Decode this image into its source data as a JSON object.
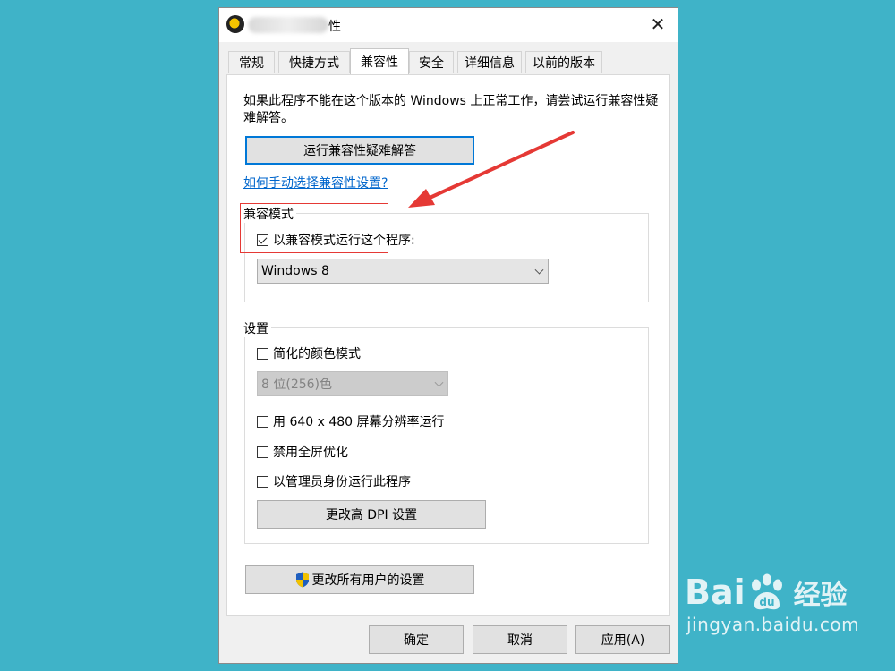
{
  "window": {
    "title_suffix": "性",
    "close_glyph": "✕"
  },
  "tabs": [
    {
      "label": "常规",
      "active": false
    },
    {
      "label": "快捷方式",
      "active": false
    },
    {
      "label": "兼容性",
      "active": true
    },
    {
      "label": "安全",
      "active": false
    },
    {
      "label": "详细信息",
      "active": false
    },
    {
      "label": "以前的版本",
      "active": false
    }
  ],
  "compat": {
    "description": "如果此程序不能在这个版本的 Windows 上正常工作，请尝试运行兼容性疑难解答。",
    "troubleshoot_button": "运行兼容性疑难解答",
    "help_link": "如何手动选择兼容性设置?"
  },
  "mode_group": {
    "label": "兼容模式",
    "checkbox_label": "以兼容模式运行这个程序:",
    "checked": true,
    "selected_os": "Windows 8"
  },
  "settings_group": {
    "label": "设置",
    "reduced_color": {
      "label": "简化的颜色模式",
      "checked": false
    },
    "color_depth": "8 位(256)色",
    "res_640": {
      "label": "用 640 x 480 屏幕分辨率运行",
      "checked": false
    },
    "disable_fullscreen": {
      "label": "禁用全屏优化",
      "checked": false
    },
    "run_as_admin": {
      "label": "以管理员身份运行此程序",
      "checked": false
    },
    "dpi_button": "更改高 DPI 设置"
  },
  "all_users_button": "更改所有用户的设置",
  "footer": {
    "ok": "确定",
    "cancel": "取消",
    "apply": "应用(A)"
  },
  "watermark": {
    "logo_left": "Bai",
    "logo_right": "经验",
    "url": "jingyan.baidu.com"
  },
  "colors": {
    "background": "#3fb3c8",
    "annotation": "#e53935",
    "link": "#0066cc",
    "focus": "#0078d7"
  }
}
